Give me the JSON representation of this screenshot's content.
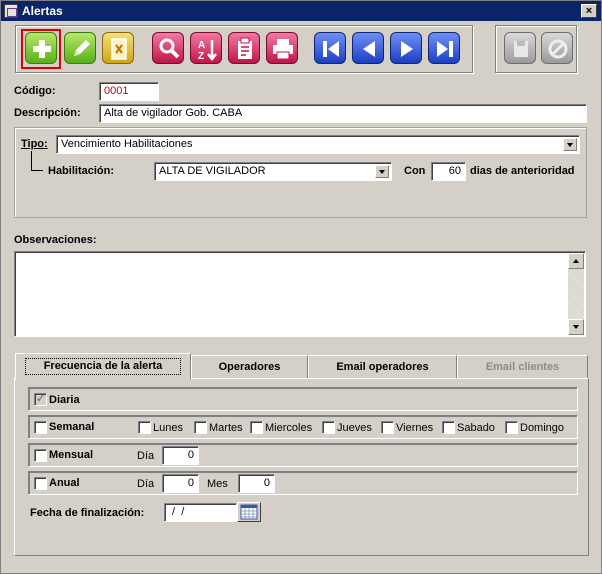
{
  "window": {
    "title": "Alertas",
    "close_glyph": "×"
  },
  "toolbar": {
    "buttons": [
      {
        "name": "add-button",
        "icon": "plus-icon",
        "color": "#58b019",
        "selected": true
      },
      {
        "name": "edit-button",
        "icon": "pencil-icon",
        "color": "#58b019"
      },
      {
        "name": "delete-button",
        "icon": "document-x-icon",
        "color": "#d1a413"
      },
      {
        "name": "search-button",
        "icon": "magnifier-icon",
        "color": "#c11548"
      },
      {
        "name": "sort-button",
        "icon": "sort-az-icon",
        "color": "#c11548"
      },
      {
        "name": "report-button",
        "icon": "clipboard-icon",
        "color": "#c11548"
      },
      {
        "name": "print-button",
        "icon": "printer-icon",
        "color": "#c11548"
      },
      {
        "name": "first-record-button",
        "icon": "first-icon",
        "color": "#1c3fc2"
      },
      {
        "name": "previous-record-button",
        "icon": "previous-icon",
        "color": "#1c3fc2"
      },
      {
        "name": "next-record-button",
        "icon": "next-icon",
        "color": "#1c3fc2"
      },
      {
        "name": "last-record-button",
        "icon": "last-icon",
        "color": "#1c3fc2"
      },
      {
        "name": "save-button",
        "icon": "save-icon",
        "color": "#9a9a9a",
        "disabled": true
      },
      {
        "name": "cancel-button",
        "icon": "cancel-icon",
        "color": "#9a9a9a",
        "disabled": true
      }
    ]
  },
  "form": {
    "codigo_label": "Código:",
    "codigo_value": "0001",
    "codigo_color": "#cc0000",
    "descripcion_label": "Descripción:",
    "descripcion_value": "Alta de vigilador Gob. CABA",
    "tipo_label": "Tipo:",
    "tipo_value": "Vencimiento Habilitaciones",
    "habilitacion_label": "Habilitación:",
    "habilitacion_value": "ALTA DE VIGILADOR",
    "con_label": "Con",
    "dias_value": "60",
    "dias_label": "dias de anterioridad",
    "observaciones_label": "Observaciones:",
    "observaciones_value": ""
  },
  "tabs": [
    {
      "label": "Frecuencia de la alerta",
      "active": true
    },
    {
      "label": "Operadores"
    },
    {
      "label": "Email operadores"
    },
    {
      "label": "Email clientes",
      "disabled": true
    }
  ],
  "frequency": {
    "diaria": {
      "label": "Diaria",
      "checked": true
    },
    "semanal": {
      "label": "Semanal",
      "days": [
        "Lunes",
        "Martes",
        "Miercoles",
        "Jueves",
        "Viernes",
        "Sabado",
        "Domingo"
      ]
    },
    "mensual": {
      "label": "Mensual",
      "dia_label": "Día",
      "dia_value": "0"
    },
    "anual": {
      "label": "Anual",
      "dia_label": "Día",
      "dia_value": "0",
      "mes_label": "Mes",
      "mes_value": "0"
    },
    "fecha_label": "Fecha de finalización:",
    "fecha_value": " /  /"
  }
}
